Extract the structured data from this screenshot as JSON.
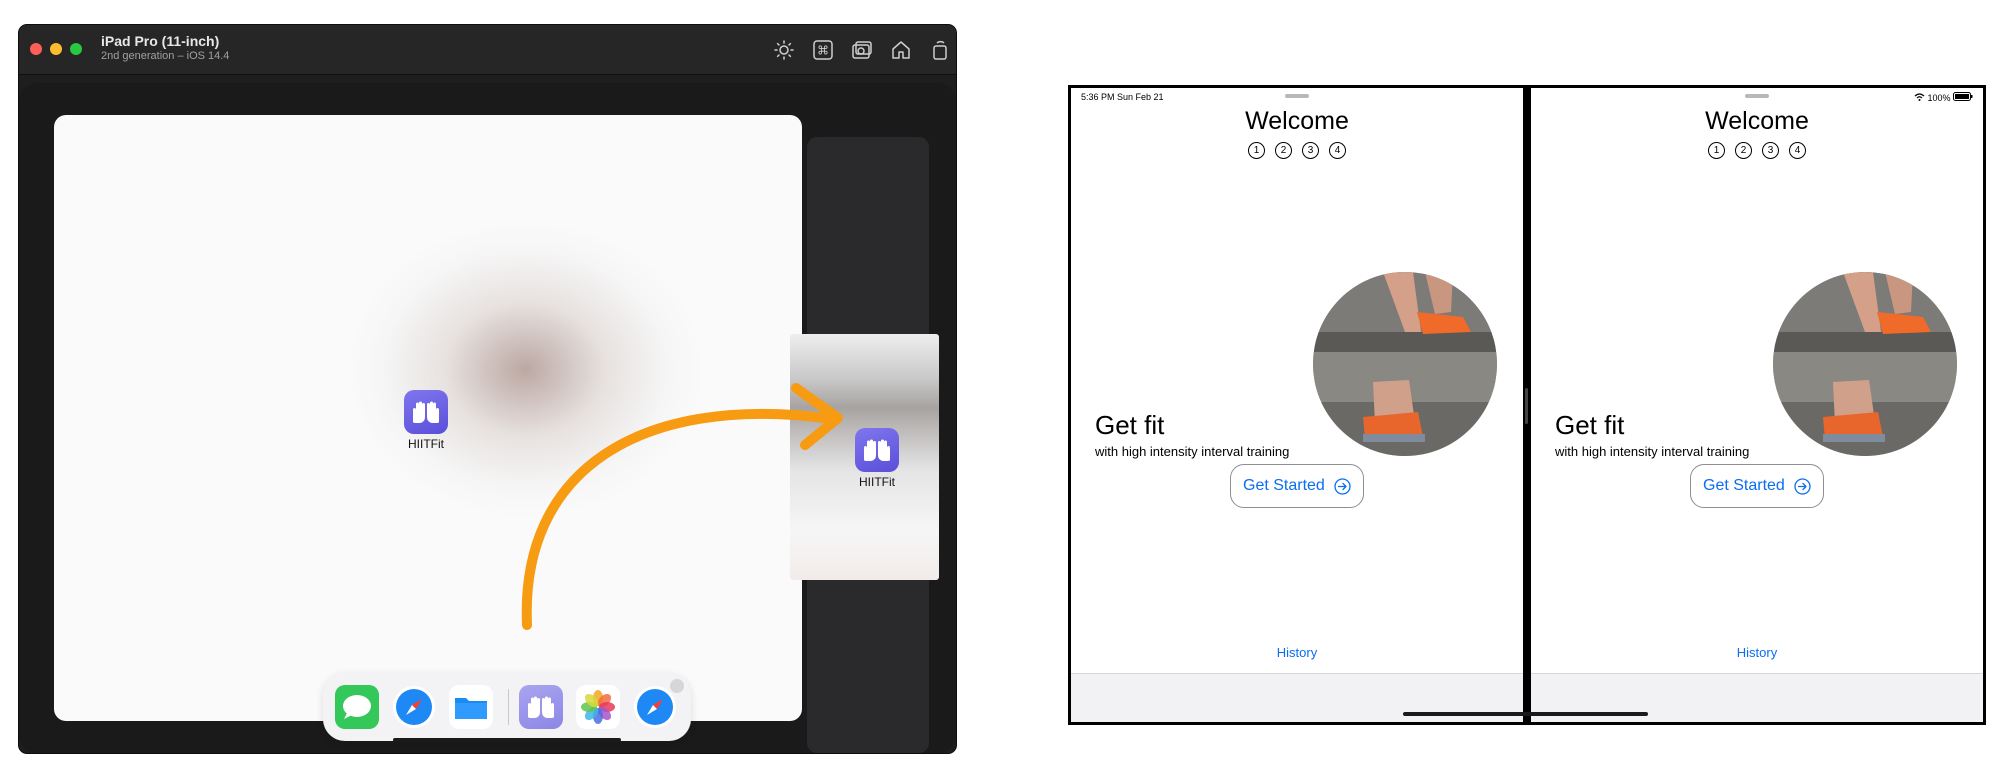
{
  "simulator": {
    "device_name": "iPad Pro (11-inch)",
    "device_detail": "2nd generation – iOS 14.4",
    "toolbar_icons": [
      "brightness-icon",
      "command-icon",
      "screenshot-icon",
      "home-icon",
      "rotate-icon"
    ]
  },
  "home_screen": {
    "app_label": "HIITFit",
    "drag_app_label": "HIITFit",
    "dock_apps": [
      "messages-icon",
      "safari-icon",
      "files-icon",
      "hiitfit-icon",
      "photos-icon",
      "safari-icon"
    ]
  },
  "split_view": {
    "status_time": "5:36 PM   Sun Feb 21",
    "status_right": "100%",
    "left": {
      "title": "Welcome",
      "pages": [
        "1",
        "2",
        "3",
        "4"
      ],
      "headline": "Get fit",
      "tagline": "with high intensity interval training",
      "button_label": "Get Started",
      "history_label": "History"
    },
    "right": {
      "title": "Welcome",
      "pages": [
        "1",
        "2",
        "3",
        "4"
      ],
      "headline": "Get fit",
      "tagline": "with high intensity interval training",
      "button_label": "Get Started",
      "history_label": "History"
    }
  },
  "colors": {
    "accent": "#0a6ef0",
    "arrow": "#f79b12",
    "app_icon": "#6b61e6"
  }
}
